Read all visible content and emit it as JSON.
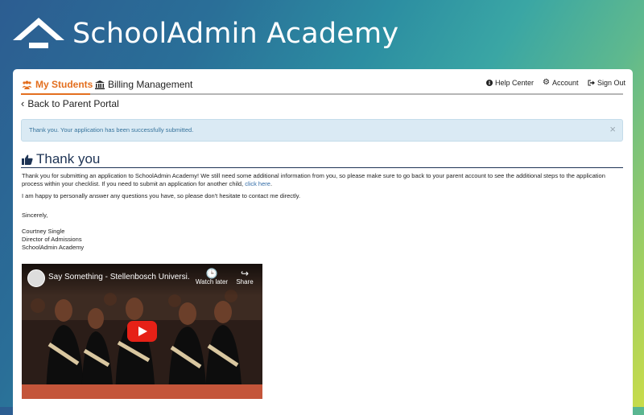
{
  "header": {
    "brand": "SchoolAdmin Academy"
  },
  "nav": {
    "tabs": [
      {
        "label": "My Students",
        "icon": "users-icon",
        "active": true
      },
      {
        "label": "Billing Management",
        "icon": "bank-icon",
        "active": false
      }
    ],
    "right": [
      {
        "label": "Help Center",
        "icon": "info-icon"
      },
      {
        "label": "Account",
        "icon": "gear-icon"
      },
      {
        "label": "Sign Out",
        "icon": "sign-out-icon"
      }
    ]
  },
  "back_link": "Back to Parent Portal",
  "alert": {
    "message": "Thank you. Your application has been successfully submitted.",
    "close": "×"
  },
  "content": {
    "heading": "Thank you",
    "paragraph1": "Thank you for submitting an application to SchoolAdmin Academy! We still need some additional information from you, so please make sure to go back to your parent account to see the additional steps to the application process within your checklist. If you need to submit an application for another child,",
    "paragraph1_link": "click here",
    "paragraph1_end": ".",
    "paragraph2": "I am happy to personally answer any questions you have, so please don't hesitate to contact me directly.",
    "closing": "Sincerely,",
    "signature": [
      "Courtney Single",
      "Director of Admissions",
      "SchoolAdmin Academy"
    ]
  },
  "video": {
    "title": "Say Something - Stellenbosch Universi...",
    "watch_later": "Watch later",
    "share": "Share"
  },
  "colors": {
    "accent": "#e36f1f",
    "heading": "#1e3455",
    "alert_bg": "#daeaf4",
    "link": "#2f6aa6"
  }
}
